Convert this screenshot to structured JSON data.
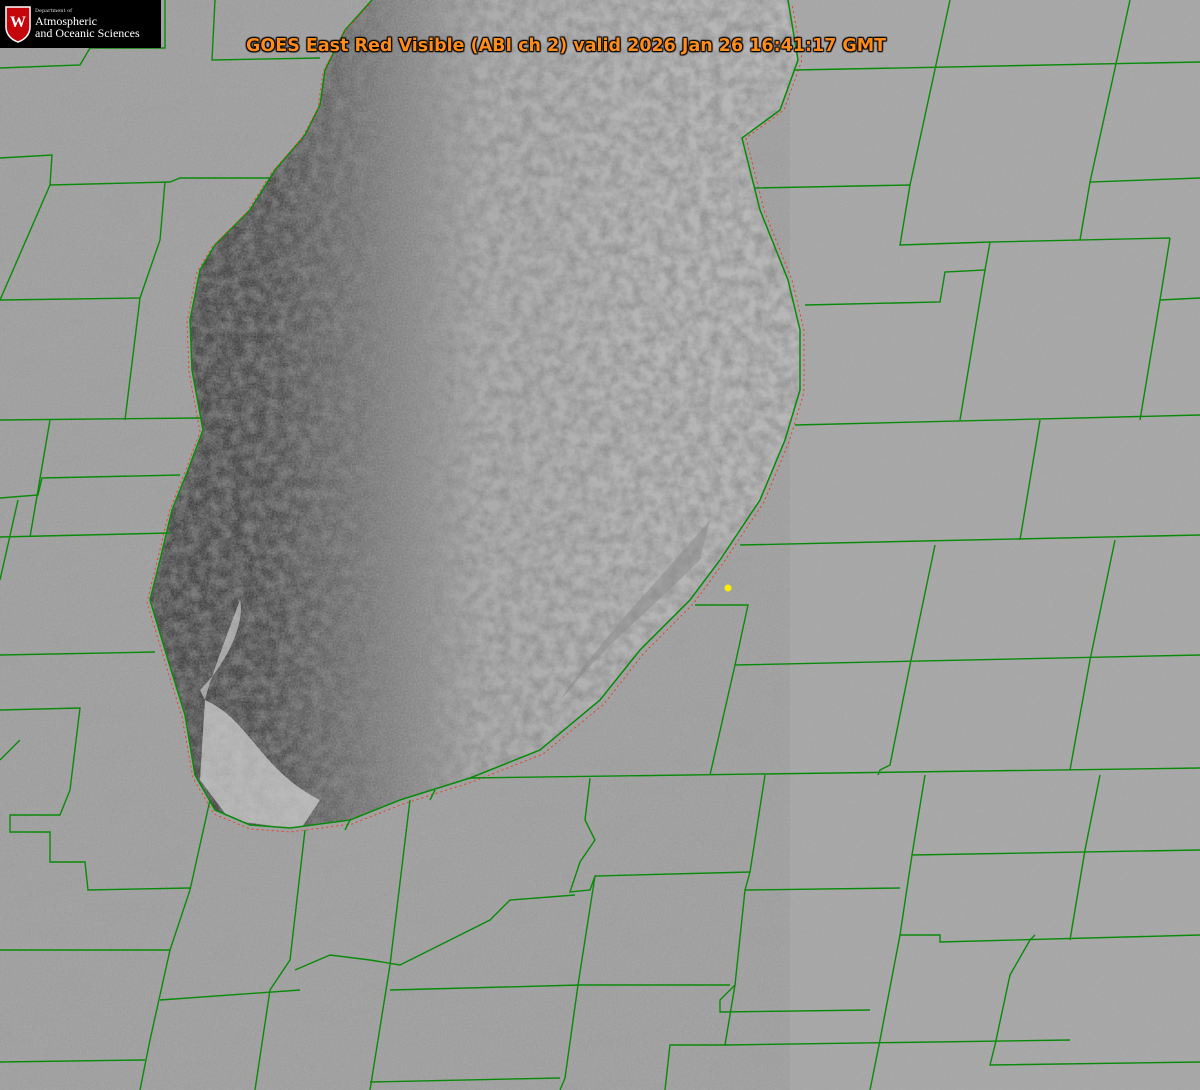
{
  "title": "GOES East Red Visible (ABI ch 2) valid 2026 Jan 26 16:41:17 GMT",
  "logo": {
    "emblem_letter": "W",
    "department_text": "Department of",
    "line1": "Atmospheric",
    "line2": "and Oceanic Sciences"
  },
  "colors": {
    "title": "#ff8c1a",
    "county_lines": "#0a8a0a",
    "coast_dotted": "#e8402a",
    "station_marker": "#ffee00",
    "emblem": "#c5050c"
  }
}
